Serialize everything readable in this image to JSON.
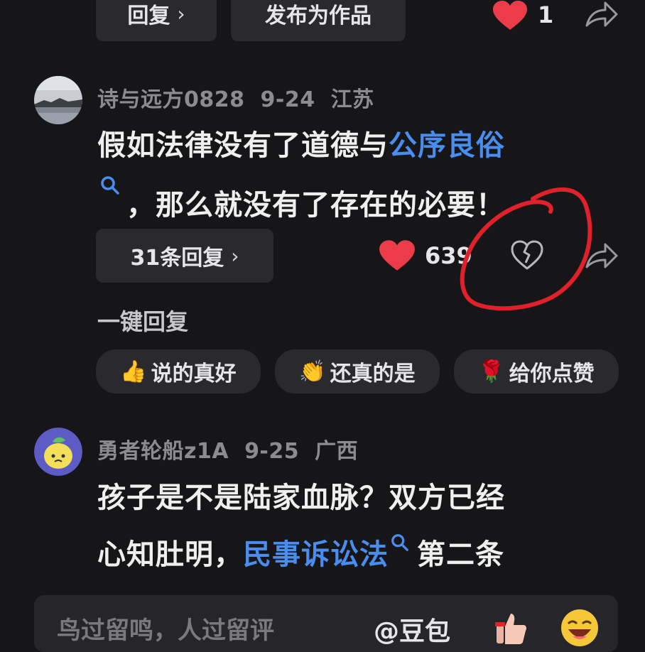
{
  "top_row": {
    "reply_label": "回复",
    "publish_label": "发布为作品",
    "like_count": "1"
  },
  "comment1": {
    "username": "诗与远方0828",
    "date": "9-24",
    "location": "江苏",
    "text_a": "假如法律没有了道德与",
    "link_text": "公序良俗",
    "text_b": "，那么就没有了存在的必要！",
    "replies_label": "31条回复",
    "like_count": "639"
  },
  "quick_reply": {
    "title": "一键回复",
    "options": [
      {
        "emoji": "👍",
        "label": "说的真好"
      },
      {
        "emoji": "👏",
        "label": "还真的是"
      },
      {
        "emoji": "🌹",
        "label": "给你点赞"
      }
    ]
  },
  "comment2": {
    "username": "勇者轮船z1A",
    "date": "9-25",
    "location": "广西",
    "line1": "孩子是不是陆家血脉？双方已经",
    "line2_a": "心知肚明，",
    "link_text": "民事诉讼法",
    "line2_b": "第二条"
  },
  "input_bar": {
    "placeholder": "鸟过留鸣，人过留评",
    "mention": "@豆包"
  },
  "colors": {
    "background": "#161619",
    "like_red": "#ec3b49",
    "link_blue": "#4a8df0",
    "annotation_red": "#e0202a"
  }
}
